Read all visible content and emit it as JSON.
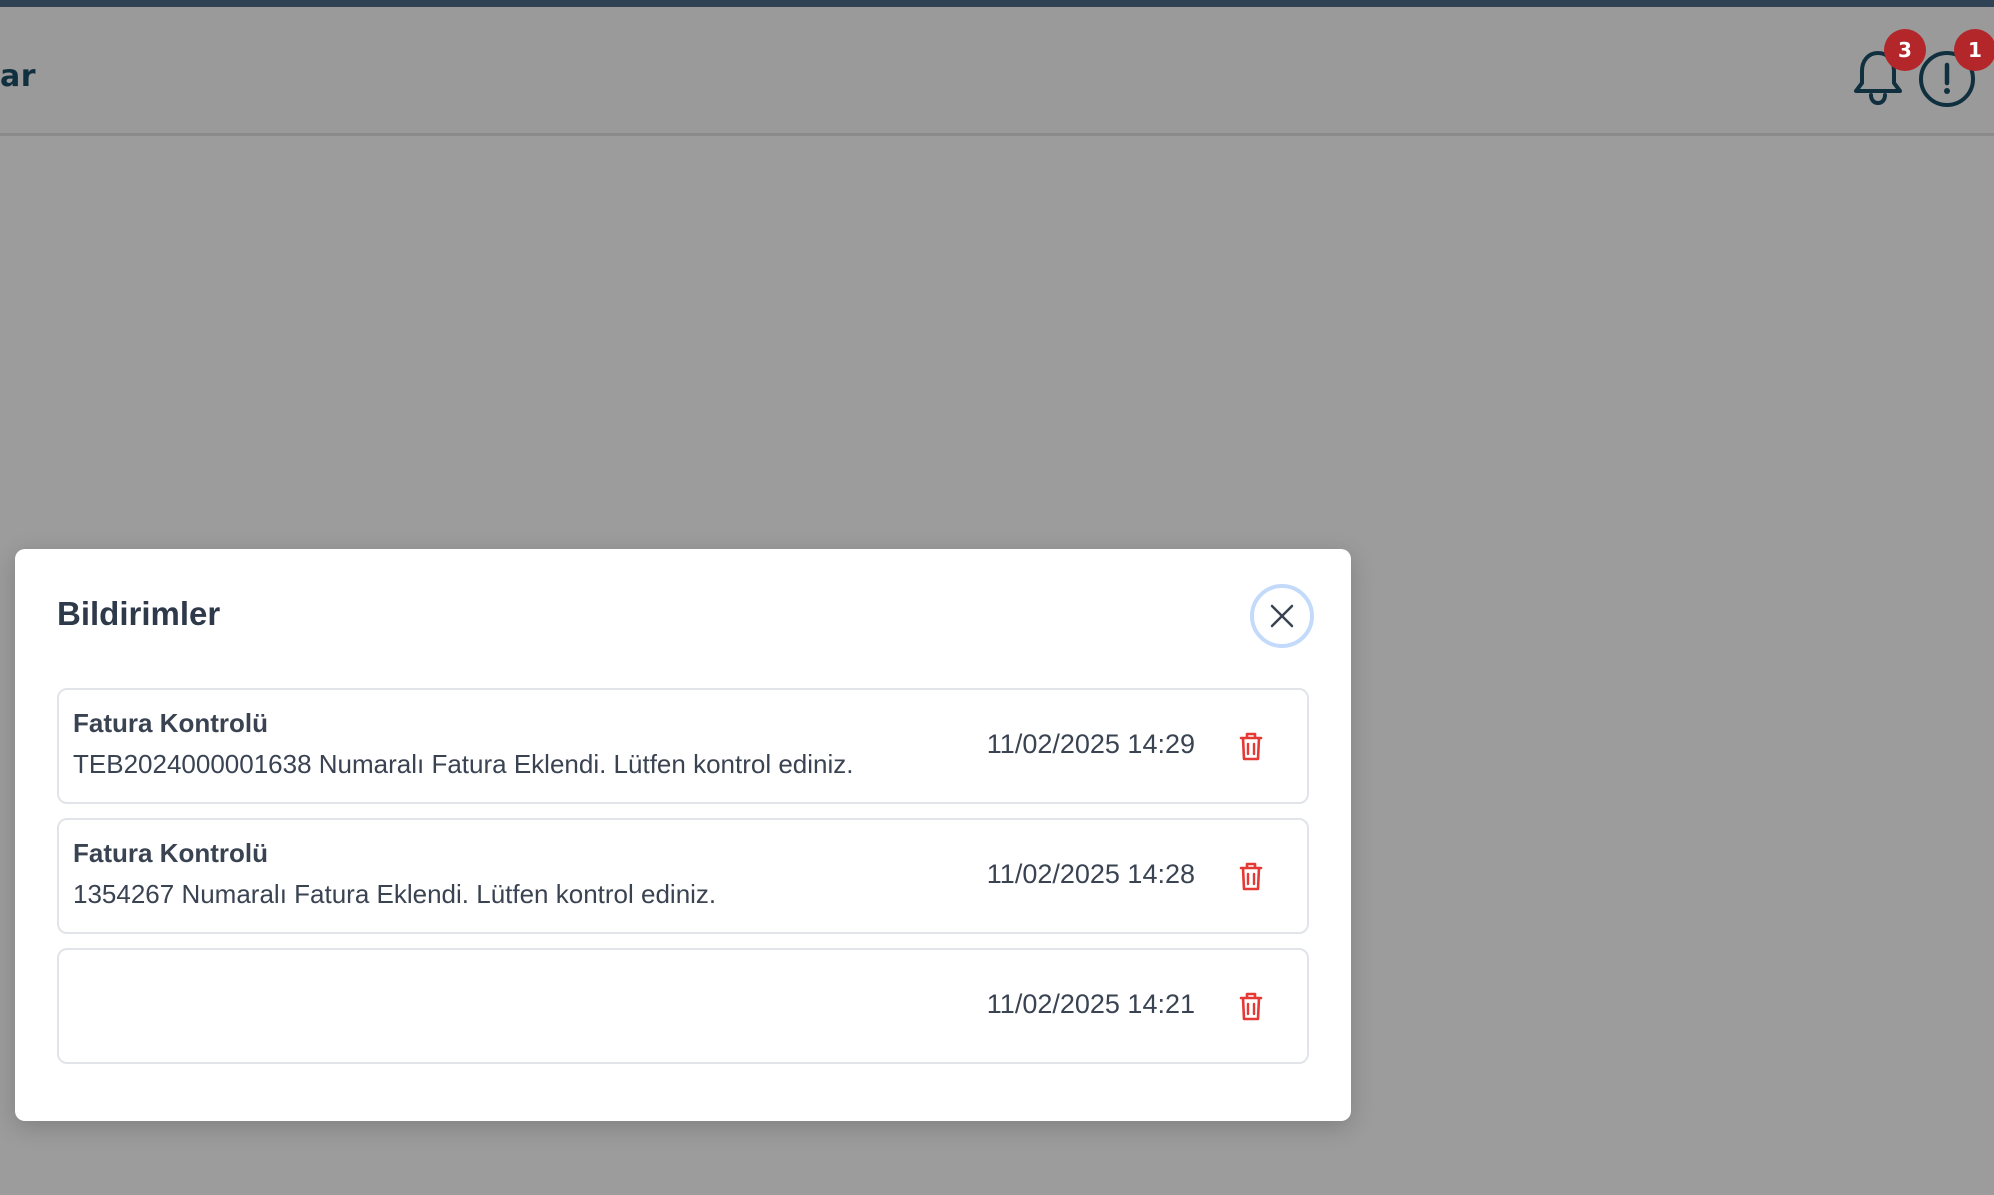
{
  "header": {
    "title_fragment": "ar",
    "notifications": {
      "icon": "bell-icon",
      "count": "3"
    },
    "alerts": {
      "icon": "exclamation-circle-icon",
      "count": "1"
    }
  },
  "modal": {
    "title": "Bildirimler",
    "close_icon": "close-icon",
    "items": [
      {
        "title": "Fatura Kontrolü",
        "message": "TEB2024000001638 Numaralı Fatura Eklendi. Lütfen kontrol ediniz.",
        "date": "11/02/2025 14:29",
        "delete_icon": "trash-icon"
      },
      {
        "title": "Fatura Kontrolü",
        "message": "1354267 Numaralı Fatura Eklendi. Lütfen kontrol ediniz.",
        "date": "11/02/2025 14:28",
        "delete_icon": "trash-icon"
      },
      {
        "title": "",
        "message": "",
        "date": "11/02/2025 14:21",
        "delete_icon": "trash-icon"
      }
    ]
  },
  "colors": {
    "overlay": "#9c9c9c",
    "accent": "#2f4355",
    "badge": "#b3262a",
    "delete": "#e53935",
    "text": "#3a4352"
  }
}
